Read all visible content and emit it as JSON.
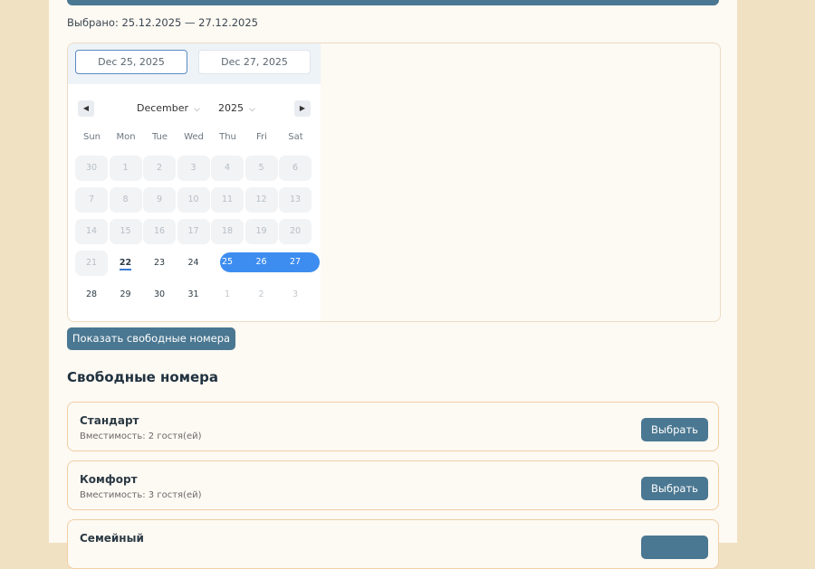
{
  "booking": {
    "selected_label": "Выбрано: 25.12.2025 — 27.12.2025"
  },
  "calendar": {
    "start_input": "Dec 25, 2025",
    "end_input": "Dec 27, 2025",
    "month": "December",
    "year": "2025",
    "weekdays": [
      "Sun",
      "Mon",
      "Tue",
      "Wed",
      "Thu",
      "Fri",
      "Sat"
    ],
    "weeks": [
      [
        "30",
        "1",
        "2",
        "3",
        "4",
        "5",
        "6"
      ],
      [
        "7",
        "8",
        "9",
        "10",
        "11",
        "12",
        "13"
      ],
      [
        "14",
        "15",
        "16",
        "17",
        "18",
        "19",
        "20"
      ],
      [
        "21",
        "22",
        "23",
        "24",
        "25",
        "26",
        "27"
      ],
      [
        "28",
        "29",
        "30",
        "31",
        "1",
        "2",
        "3"
      ]
    ]
  },
  "actions": {
    "show_rooms": "Показать свободные номера"
  },
  "rooms": {
    "title": "Свободные номера",
    "items": [
      {
        "name": "Стандарт",
        "capacity": "Вместимость: 2 гостя(ей)",
        "button": "Выбрать"
      },
      {
        "name": "Комфорт",
        "capacity": "Вместимость: 3 гостя(ей)",
        "button": "Выбрать"
      },
      {
        "name": "Семейный",
        "capacity": "",
        "button": ""
      }
    ]
  },
  "colors": {
    "accent": "#4a7791",
    "range": "#3d8df0",
    "background": "#f1e1c3"
  }
}
